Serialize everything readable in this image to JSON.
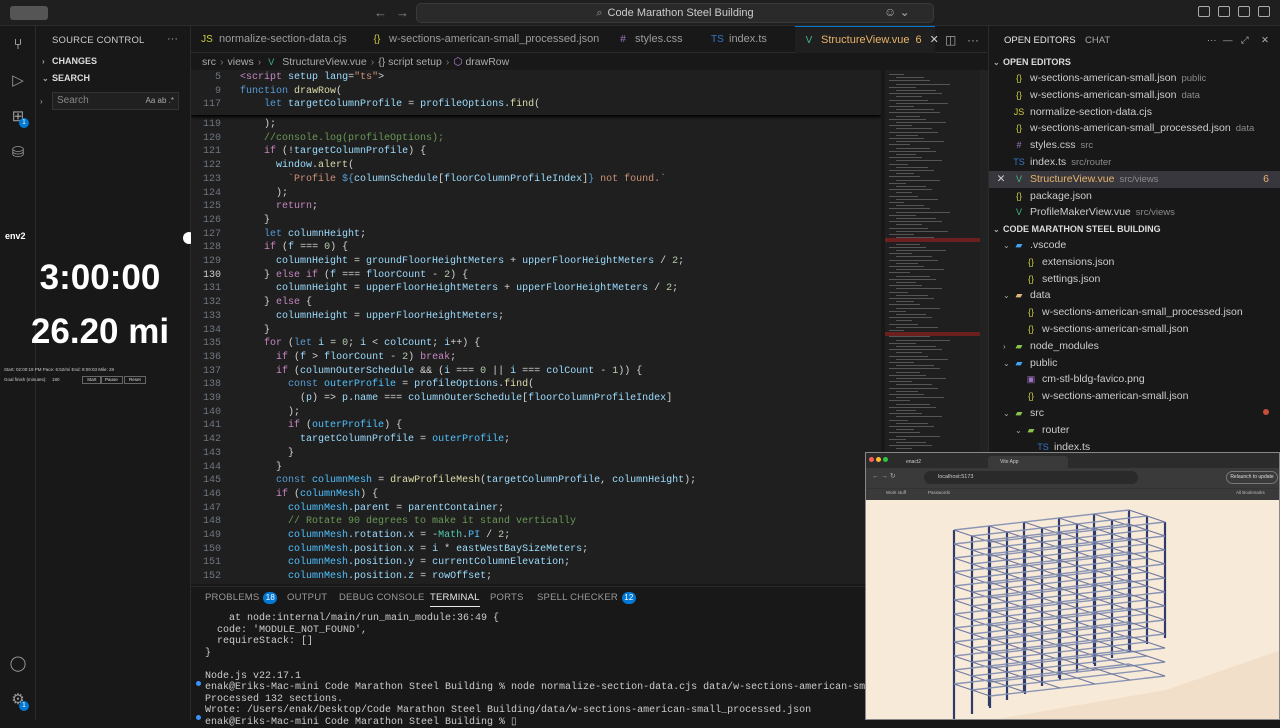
{
  "window": {
    "title": "Code Marathon Steel Building"
  },
  "activity": {
    "source_control_badge": "1",
    "extensions_badge": "1",
    "settings_badge": "1"
  },
  "sidebar": {
    "title": "SOURCE CONTROL",
    "changes": "CHANGES",
    "search_title": "SEARCH",
    "search_placeholder": "Search",
    "search_options": "Aa ab .*"
  },
  "overlay": {
    "tag": "env2",
    "time": "3:00:00",
    "distance": "26.20 mi",
    "stats": "Start: 02:00:19 PM   Pace: 6:52/mi   End: 8:09:03   Mile: 28",
    "goal_label": "Goal finish (minutes):",
    "goal_value": "180",
    "buttons": [
      "Start",
      "Pause",
      "Reset"
    ]
  },
  "tabs": [
    {
      "label": "normalize-section-data.cjs",
      "icon": "JS"
    },
    {
      "label": "w-sections-american-small_processed.json",
      "icon": "{}"
    },
    {
      "label": "styles.css",
      "icon": "#"
    },
    {
      "label": "index.ts",
      "icon": "TS"
    },
    {
      "label": "StructureView.vue",
      "icon": "V",
      "problems": "6"
    }
  ],
  "breadcrumb": [
    "src",
    "views",
    "StructureView.vue",
    "script setup",
    "drawRow"
  ],
  "editor": {
    "sticky": [
      {
        "n": "5",
        "html": "<span class='k'>&lt;script</span> <span class='v'>setup</span> <span class='v'>lang</span>=<span class='s'>\"ts\"</span>&gt;"
      },
      {
        "n": "9",
        "html": "<span class='kb'>function</span> <span class='f'>drawRow</span>("
      },
      {
        "n": "117",
        "html": "    <span class='kb'>let</span> <span class='v'>targetColumnProfile</span> = <span class='v'>profileOptions</span>.<span class='f'>find</span>("
      }
    ],
    "lines": [
      {
        "n": "119",
        "html": "    );"
      },
      {
        "n": "120",
        "html": "    <span class='c'>//console.log(profileOptions);</span>"
      },
      {
        "n": "121",
        "html": "    <span class='k'>if</span> (!<span class='v'>targetColumnProfile</span>) {"
      },
      {
        "n": "122",
        "html": "      <span class='v'>window</span>.<span class='f'>alert</span>("
      },
      {
        "n": "123",
        "html": "        <span class='s'>`Profile </span><span class='kb'>${</span><span class='v'>columnSchedule</span>[<span class='v'>floorColumnProfileIndex</span>]<span class='kb'>}</span><span class='s'> not found.`</span>"
      },
      {
        "n": "124",
        "html": "      );"
      },
      {
        "n": "125",
        "html": "      <span class='k'>return</span>;"
      },
      {
        "n": "126",
        "html": "    }"
      },
      {
        "n": "127",
        "html": "    <span class='kb'>let</span> <span class='v'>columnHeight</span>;"
      },
      {
        "n": "128",
        "html": "    <span class='k'>if</span> (<span class='v'>f</span> === <span class='n'>0</span>) {"
      },
      {
        "n": "129",
        "html": "      <span class='v'>columnHeight</span> = <span class='v'>groundFloorHeightMeters</span> + <span class='v'>upperFloorHeightMeters</span> / <span class='n'>2</span>;"
      },
      {
        "n": "130",
        "html": "    } <span class='k'>else if</span> (<span class='v'>f</span> === <span class='v'>floorCount</span> - <span class='n'>2</span>) {"
      },
      {
        "n": "131",
        "html": "      <span class='v'>columnHeight</span> = <span class='v'>upperFloorHeightMeters</span> + <span class='v'>upperFloorHeightMeters</span> / <span class='n'>2</span>;"
      },
      {
        "n": "132",
        "html": "    } <span class='k'>else</span> {"
      },
      {
        "n": "133",
        "html": "      <span class='v'>columnHeight</span> = <span class='v'>upperFloorHeightMeters</span>;"
      },
      {
        "n": "134",
        "html": "    }"
      },
      {
        "n": "135",
        "html": "    <span class='k'>for</span> (<span class='kb'>let</span> <span class='v'>i</span> = <span class='n'>0</span>; <span class='v'>i</span> &lt; <span class='v'>colCount</span>; <span class='v'>i</span>++) {"
      },
      {
        "n": "136",
        "html": "      <span class='k'>if</span> (<span class='v'>f</span> &gt; <span class='v'>floorCount</span> - <span class='n'>2</span>) <span class='k'>break</span>;"
      },
      {
        "n": "137",
        "html": "      <span class='k'>if</span> (<span class='v'>columnOuterSchedule</span> &amp;&amp; (<span class='v'>i</span> === <span class='n'>0</span> || <span class='v'>i</span> === <span class='v'>colCount</span> - <span class='n'>1</span>)) {"
      },
      {
        "n": "138",
        "html": "        <span class='kb'>const</span> <span class='cst'>outerProfile</span> = <span class='v'>profileOptions</span>.<span class='f'>find</span>("
      },
      {
        "n": "139",
        "html": "          (<span class='v'>p</span>) =&gt; <span class='v'>p</span>.<span class='v'>name</span> === <span class='v'>columnOuterSchedule</span>[<span class='v'>floorColumnProfileIndex</span>]"
      },
      {
        "n": "140",
        "html": "        );"
      },
      {
        "n": "141",
        "html": "        <span class='k'>if</span> (<span class='cst'>outerProfile</span>) {"
      },
      {
        "n": "142",
        "html": "          <span class='v'>targetColumnProfile</span> = <span class='cst'>outerProfile</span>;"
      },
      {
        "n": "143",
        "html": "        }"
      },
      {
        "n": "144",
        "html": "      }"
      },
      {
        "n": "145",
        "html": "      <span class='kb'>const</span> <span class='cst'>columnMesh</span> = <span class='f'>drawProfileMesh</span>(<span class='v'>targetColumnProfile</span>, <span class='v'>columnHeight</span>);"
      },
      {
        "n": "146",
        "html": "      <span class='k'>if</span> (<span class='cst'>columnMesh</span>) {"
      },
      {
        "n": "147",
        "html": "        <span class='cst'>columnMesh</span>.<span class='v'>parent</span> = <span class='v'>parentContainer</span>;"
      },
      {
        "n": "148",
        "html": "        <span class='c'>// Rotate 90 degrees to make it stand vertically</span>"
      },
      {
        "n": "149",
        "html": "        <span class='cst'>columnMesh</span>.<span class='v'>rotation</span>.<span class='v'>x</span> = -<span class='t'>Math</span>.<span class='cst'>PI</span> / <span class='n'>2</span>;"
      },
      {
        "n": "150",
        "html": "        <span class='cst'>columnMesh</span>.<span class='v'>position</span>.<span class='v'>x</span> = <span class='v'>i</span> * <span class='v'>eastWestBaySizeMeters</span>;"
      },
      {
        "n": "151",
        "html": "        <span class='cst'>columnMesh</span>.<span class='v'>position</span>.<span class='v'>y</span> = <span class='v'>currentColumnElevation</span>;"
      },
      {
        "n": "152",
        "html": "        <span class='cst'>columnMesh</span>.<span class='v'>position</span>.<span class='v'>z</span> = <span class='v'>rowOffset</span>;"
      }
    ]
  },
  "panel": {
    "tabs": [
      {
        "label": "PROBLEMS",
        "badge": "18"
      },
      {
        "label": "OUTPUT"
      },
      {
        "label": "DEBUG CONSOLE"
      },
      {
        "label": "TERMINAL"
      },
      {
        "label": "PORTS"
      },
      {
        "label": "SPELL CHECKER",
        "badge": "12"
      }
    ],
    "terminal": [
      "    at node:internal/main/run_main_module:36:49 {",
      "  code: 'MODULE_NOT_FOUND',",
      "  requireStack: []",
      "}",
      "",
      "Node.js v22.17.1",
      "enak@Eriks-Mac-mini Code Marathon Steel Building % node normalize-section-data.cjs data/w-sections-american-small.json",
      "Processed 132 sections.",
      "Wrote: /Users/enak/Desktop/Code Marathon Steel Building/data/w-sections-american-small_processed.json",
      "enak@Eriks-Mac-mini Code Marathon Steel Building % ▯"
    ]
  },
  "right": {
    "tab_open_editors": "OPEN EDITORS",
    "tab_chat": "CHAT",
    "open_editors_title": "OPEN EDITORS",
    "open_editors": [
      {
        "name": "w-sections-american-small.json",
        "desc": "public",
        "type": "json",
        "glyph": "{}"
      },
      {
        "name": "w-sections-american-small.json",
        "desc": "data",
        "type": "json",
        "glyph": "{}"
      },
      {
        "name": "normalize-section-data.cjs",
        "desc": "",
        "type": "js",
        "glyph": "JS"
      },
      {
        "name": "w-sections-american-small_processed.json",
        "desc": "data",
        "type": "json",
        "glyph": "{}"
      },
      {
        "name": "styles.css",
        "desc": "src",
        "type": "css",
        "glyph": "#"
      },
      {
        "name": "index.ts",
        "desc": "src/router",
        "type": "ts",
        "glyph": "TS"
      },
      {
        "name": "StructureView.vue",
        "desc": "src/views",
        "type": "vue",
        "glyph": "V",
        "count": "6"
      },
      {
        "name": "package.json",
        "desc": "",
        "type": "json",
        "glyph": "{}"
      },
      {
        "name": "ProfileMakerView.vue",
        "desc": "src/views",
        "type": "vue",
        "glyph": "V"
      }
    ],
    "project_title": "CODE MARATHON STEEL BUILDING",
    "tree": [
      {
        "name": ".vscode",
        "type": "fblue",
        "glyph": "▰",
        "indent": 1,
        "chev": "⌄"
      },
      {
        "name": "extensions.json",
        "type": "json",
        "glyph": "{}",
        "indent": 2
      },
      {
        "name": "settings.json",
        "type": "json",
        "glyph": "{}",
        "indent": 2
      },
      {
        "name": "data",
        "type": "folder",
        "glyph": "▰",
        "indent": 1,
        "chev": "⌄"
      },
      {
        "name": "w-sections-american-small_processed.json",
        "type": "json",
        "glyph": "{}",
        "indent": 2
      },
      {
        "name": "w-sections-american-small.json",
        "type": "json",
        "glyph": "{}",
        "indent": 2
      },
      {
        "name": "node_modules",
        "type": "fsrc",
        "glyph": "▰",
        "indent": 1,
        "chev": "›"
      },
      {
        "name": "public",
        "type": "fblue",
        "glyph": "▰",
        "indent": 1,
        "chev": "⌄"
      },
      {
        "name": "cm-stl-bldg-favico.png",
        "type": "png",
        "glyph": "▣",
        "indent": 2
      },
      {
        "name": "w-sections-american-small.json",
        "type": "json",
        "glyph": "{}",
        "indent": 2
      },
      {
        "name": "src",
        "type": "fsrc",
        "glyph": "▰",
        "indent": 1,
        "chev": "⌄"
      },
      {
        "name": "router",
        "type": "fsrc",
        "glyph": "▰",
        "indent": 2,
        "chev": "⌄"
      },
      {
        "name": "index.ts",
        "type": "ts",
        "glyph": "TS",
        "indent": 3
      }
    ]
  },
  "browser": {
    "tabs": [
      "enact2",
      "Vite App"
    ],
    "url": "localhost:5173",
    "relaunch": "Relaunch to update",
    "bookmarks": [
      "Work stuff",
      "Passwords"
    ],
    "all_bookmarks": "All Bookmarks"
  }
}
